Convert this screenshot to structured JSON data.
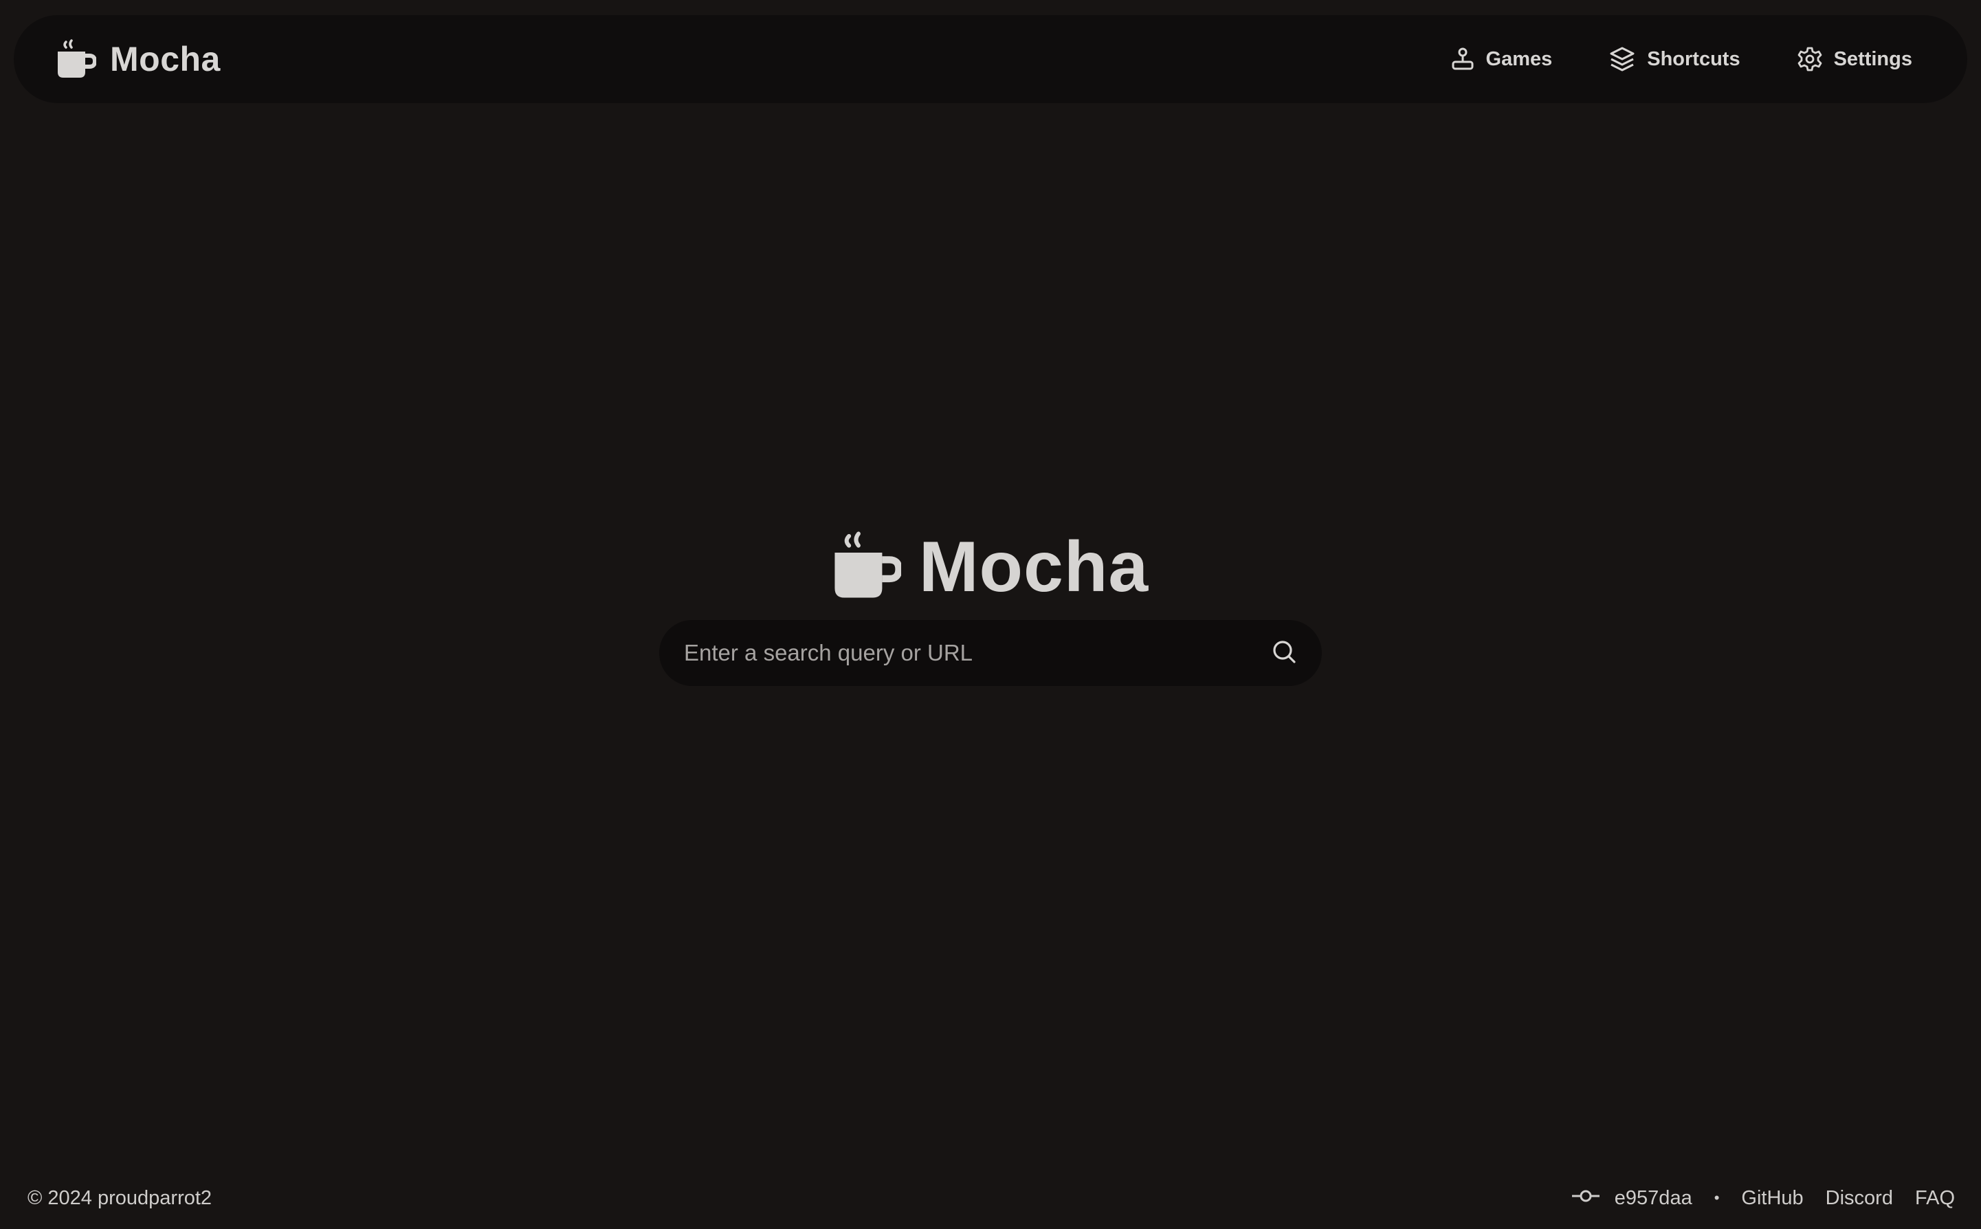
{
  "header": {
    "brand_name": "Mocha",
    "brand_icon": "coffee-cup-icon",
    "nav": [
      {
        "label": "Games",
        "icon": "joystick-icon"
      },
      {
        "label": "Shortcuts",
        "icon": "layers-icon"
      },
      {
        "label": "Settings",
        "icon": "gear-icon"
      }
    ]
  },
  "hero": {
    "name": "Mocha",
    "icon": "coffee-cup-icon"
  },
  "search": {
    "placeholder": "Enter a search query or URL",
    "value": "",
    "icon": "search-icon"
  },
  "footer": {
    "copyright": "© 2024 proudparrot2",
    "commit_icon": "git-commit-icon",
    "commit": "e957daa",
    "separator": "•",
    "links": [
      "GitHub",
      "Discord",
      "FAQ"
    ]
  },
  "colors": {
    "background": "#171413",
    "bar": "#0f0d0d",
    "text": "#d8d6d4"
  }
}
